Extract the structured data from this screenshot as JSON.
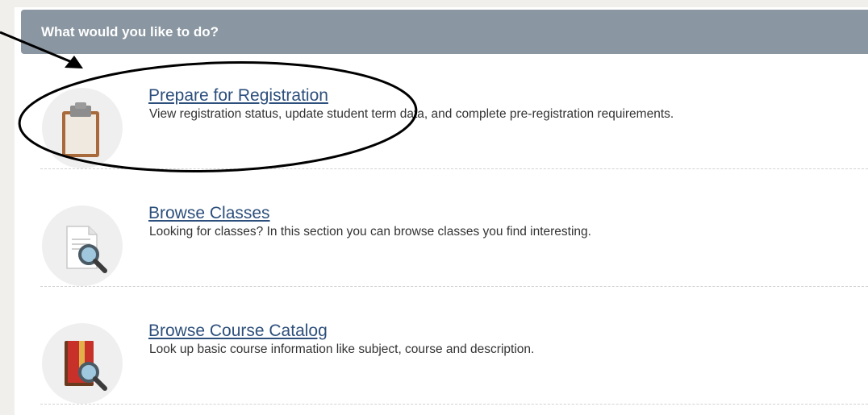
{
  "header": {
    "title": "What would you like to do?"
  },
  "items": [
    {
      "title": "Prepare for Registration",
      "description": "View registration status, update student term data, and complete pre-registration requirements.",
      "icon": "clipboard-icon"
    },
    {
      "title": "Browse Classes",
      "description": "Looking for classes? In this section you can browse classes you find interesting.",
      "icon": "document-search-icon"
    },
    {
      "title": "Browse Course Catalog",
      "description": "Look up basic course information like subject, course and description.",
      "icon": "catalog-search-icon"
    }
  ],
  "colors": {
    "header_bg": "#8a96a1",
    "link": "#2d4f7c",
    "page_bg": "#f0efec",
    "clipboard_brown": "#a86a3a",
    "catalog_red": "#c8312a"
  }
}
